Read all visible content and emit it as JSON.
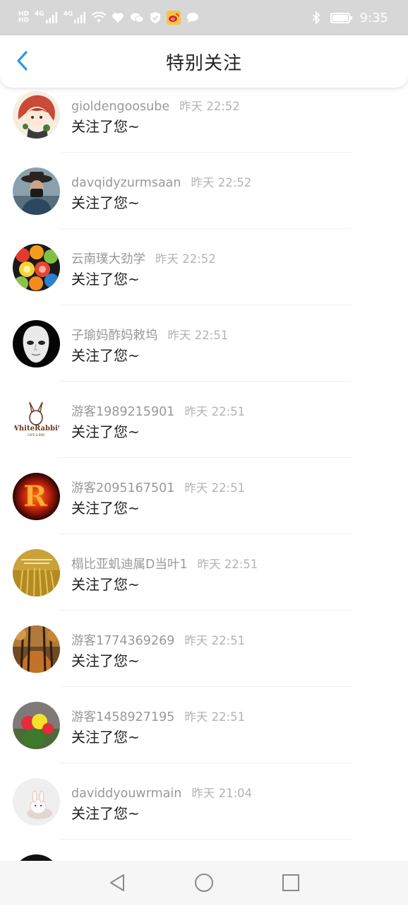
{
  "status_bar": {
    "time": "9:35",
    "left_small_top": "HD",
    "left_small_bottom": "HD",
    "net1": "4G",
    "net2": "4G",
    "icons": [
      "signal-icon",
      "wifi-icon",
      "heart-icon",
      "wechat-icon",
      "shield-icon",
      "weibo-icon",
      "chat-bubble-icon",
      "bluetooth-icon",
      "battery-icon"
    ]
  },
  "header": {
    "title": "特别关注"
  },
  "items": [
    {
      "name": "gioldengoosube",
      "time": "昨天 22:52",
      "message": "关注了您~"
    },
    {
      "name": "davqidyzurmsaan",
      "time": "昨天 22:52",
      "message": "关注了您~"
    },
    {
      "name": "云南璞大劲学",
      "time": "昨天 22:52",
      "message": "关注了您~"
    },
    {
      "name": "子瑜妈酢妈敕坞",
      "time": "昨天 22:51",
      "message": "关注了您~"
    },
    {
      "name": "游客1989215901",
      "time": "昨天 22:51",
      "message": "关注了您~"
    },
    {
      "name": "游客2095167501",
      "time": "昨天 22:51",
      "message": "关注了您~"
    },
    {
      "name": "榻比亚虮迪属D当叶1",
      "time": "昨天 22:51",
      "message": "关注了您~"
    },
    {
      "name": "游客1774369269",
      "time": "昨天 22:51",
      "message": "关注了您~"
    },
    {
      "name": "游客1458927195",
      "time": "昨天 22:51",
      "message": "关注了您~"
    },
    {
      "name": "daviddyouwrmain",
      "time": "昨天 21:04",
      "message": "关注了您~"
    }
  ],
  "avatars": {
    "whiterabbit_text": "WhiteRabbit",
    "whiterabbit_sub": "CAFE & BAR",
    "r_letter": "R"
  },
  "colors": {
    "accent": "#2f97e6",
    "name_text": "#999999",
    "message_text": "#222222",
    "status_bar_bg": "#d7d7d7"
  }
}
